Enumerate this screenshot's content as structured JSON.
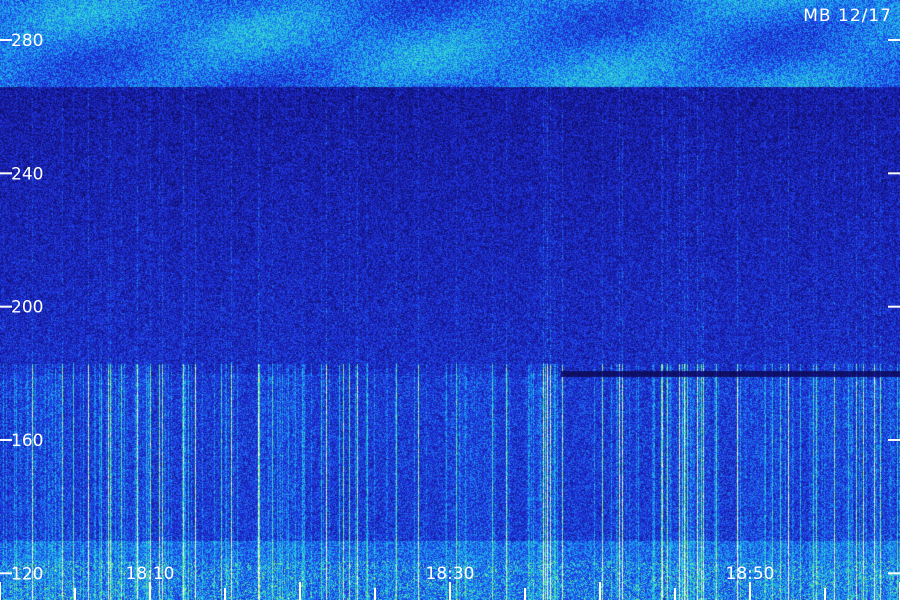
{
  "station_label": "MB 12/17",
  "chart_data": {
    "type": "heatmap",
    "title": "",
    "xlabel": "",
    "ylabel": "",
    "ylim": [
      112,
      292
    ],
    "y_ticks": [
      120,
      160,
      200,
      240,
      280
    ],
    "y_tick_labels": [
      "120",
      "160",
      "200",
      "240",
      "280"
    ],
    "x_ticks": [
      "18:10",
      "18:30",
      "18:50"
    ],
    "x_range": [
      "18:00",
      "18:60"
    ],
    "colormap": [
      "#0a0a3c",
      "#16169a",
      "#1f3be8",
      "#1aa6ee",
      "#3ee4c8",
      "#9cf25a",
      "#ffffff"
    ],
    "features": [
      {
        "name": "bright band top",
        "y_range": [
          266,
          292
        ],
        "intensity": 0.55
      },
      {
        "name": "dark gap",
        "y_range": [
          180,
          266
        ],
        "intensity": 0.22
      },
      {
        "name": "vertical bursts",
        "y_range": [
          112,
          180
        ],
        "intensity": 0.5
      },
      {
        "name": "dark horizontal line",
        "y": 180
      }
    ]
  }
}
